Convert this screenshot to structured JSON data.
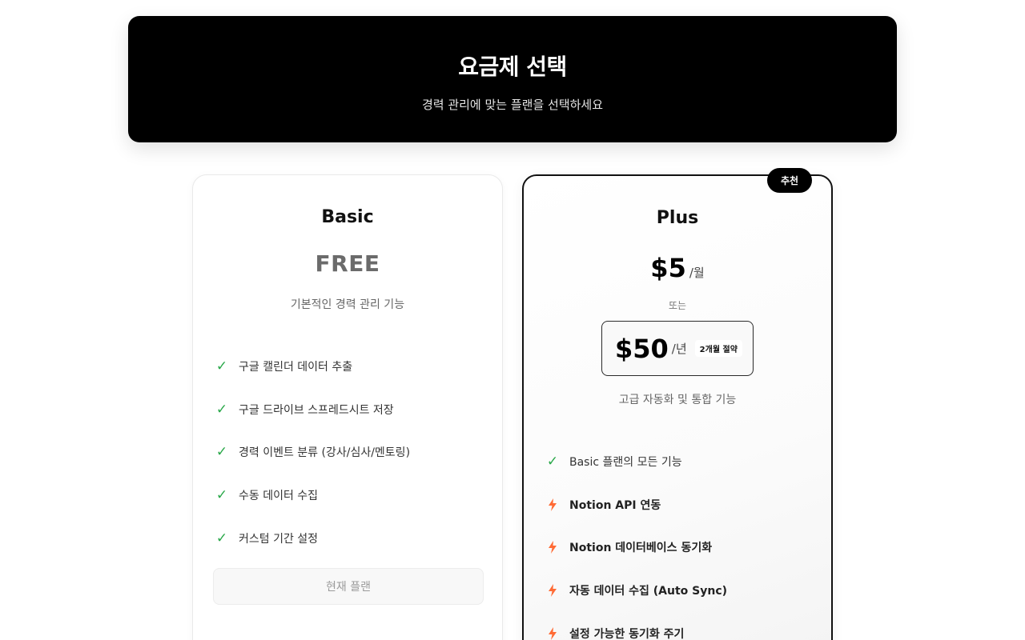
{
  "header": {
    "title": "요금제 선택",
    "subtitle": "경력 관리에 맞는 플랜을 선택하세요"
  },
  "colors": {
    "header_bg": "#000000",
    "check": "#2aa84a",
    "bolt": "#ff6b35",
    "free_price": "#6b6b6b"
  },
  "plans": {
    "basic": {
      "name": "Basic",
      "price": "FREE",
      "description": "기본적인 경력 관리 기능",
      "features": [
        {
          "icon": "check-icon",
          "text": "구글 캘린더 데이터 추출"
        },
        {
          "icon": "check-icon",
          "text": "구글 드라이브 스프레드시트 저장"
        },
        {
          "icon": "check-icon",
          "text": "경력 이벤트 분류 (강사/심사/멘토링)"
        },
        {
          "icon": "check-icon",
          "text": "수동 데이터 수집"
        },
        {
          "icon": "check-icon",
          "text": "커스텀 기간 설정"
        }
      ],
      "button_label": "현재 플랜"
    },
    "plus": {
      "badge": "추천",
      "name": "Plus",
      "monthly_price": "$5",
      "monthly_unit": "/월",
      "or_text": "또는",
      "yearly_price": "$50",
      "yearly_unit": "/년",
      "yearly_save": "2개월 절약",
      "description": "고급 자동화 및 통합 기능",
      "features": [
        {
          "icon": "check-icon",
          "text": "Basic 플랜의 모든 기능"
        },
        {
          "icon": "bolt-icon",
          "text": "Notion API 연동"
        },
        {
          "icon": "bolt-icon",
          "text": "Notion 데이터베이스 동기화"
        },
        {
          "icon": "bolt-icon",
          "text": "자동 데이터 수집 (Auto Sync)"
        },
        {
          "icon": "bolt-icon",
          "text": "설정 가능한 동기화 주기"
        }
      ]
    }
  }
}
